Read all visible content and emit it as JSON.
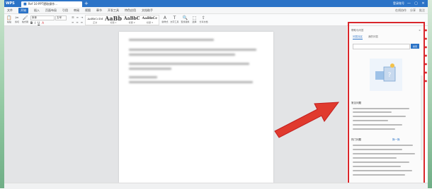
{
  "app": {
    "name": "WPS",
    "doc_tab": "Ref 10-PPT提取操作...",
    "new_tab_glyph": "+",
    "colors": {
      "accent": "#2b73c7",
      "highlight": "#d9262b"
    }
  },
  "titlebar": {
    "right_text": "登录账号",
    "minimize": "—",
    "maximize": "▢",
    "close": "✕"
  },
  "menubar": {
    "items": [
      "文件",
      "开始",
      "插入",
      "页面布局",
      "引用",
      "审阅",
      "视图",
      "章节",
      "开发工具",
      "特色应用",
      "文档助手"
    ],
    "active_index": 1,
    "right_items": [
      "在线协作",
      "分享",
      "批注"
    ]
  },
  "ribbon": {
    "tools": [
      {
        "icon": "paste-icon",
        "glyph": "📋",
        "label": "粘贴"
      },
      {
        "icon": "cut-icon",
        "glyph": "✂",
        "label": "剪切"
      },
      {
        "icon": "format-painter-icon",
        "glyph": "🖌",
        "label": "格式刷"
      }
    ],
    "font_name": "宋体",
    "font_size": "五号",
    "formatting": [
      "B",
      "I",
      "U",
      "A"
    ],
    "styles": [
      {
        "sample": "AaBbCcDd",
        "name": "正文"
      },
      {
        "sample": "AaBb",
        "name": "标题 1"
      },
      {
        "sample": "AaBbC",
        "name": "标题 2"
      },
      {
        "sample": "AaBbCc",
        "name": "标题 3"
      }
    ],
    "right_tools": [
      {
        "icon": "new-style-icon",
        "glyph": "A",
        "label": "新样式"
      },
      {
        "icon": "text-tool-icon",
        "glyph": "T",
        "label": "文字工具"
      },
      {
        "icon": "find-replace-icon",
        "glyph": "🔍",
        "label": "查找替换"
      },
      {
        "icon": "select-icon",
        "glyph": "⬚",
        "label": "选择"
      },
      {
        "icon": "share-icon",
        "glyph": "⇪",
        "label": "分享文档"
      }
    ]
  },
  "pane": {
    "title": "帮助与问答",
    "close_glyph": "×",
    "tabs": [
      "问答社区",
      "我的问答"
    ],
    "search_button": "搜索",
    "section1": "常见问题",
    "section2": "热门问题",
    "section2_more": "换一换"
  }
}
